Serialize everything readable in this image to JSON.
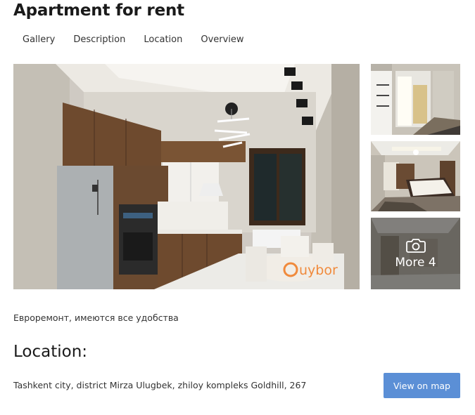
{
  "listing": {
    "title": "Apartment for rent",
    "description": "Евроремонт, имеются все удобства"
  },
  "tabs": [
    {
      "label": "Gallery"
    },
    {
      "label": "Description"
    },
    {
      "label": "Location"
    },
    {
      "label": "Overview"
    }
  ],
  "gallery": {
    "watermark": "uybor",
    "more_label": "More 4",
    "more_icon": "camera-icon"
  },
  "location": {
    "heading": "Location:",
    "address": "Tashkent city, district Mirza Ulugbek, zhiloy kompleks Goldhill, 267",
    "map_button_label": "View on map"
  },
  "colors": {
    "button": "#5b8fd6",
    "watermark": "#f08a3c"
  }
}
